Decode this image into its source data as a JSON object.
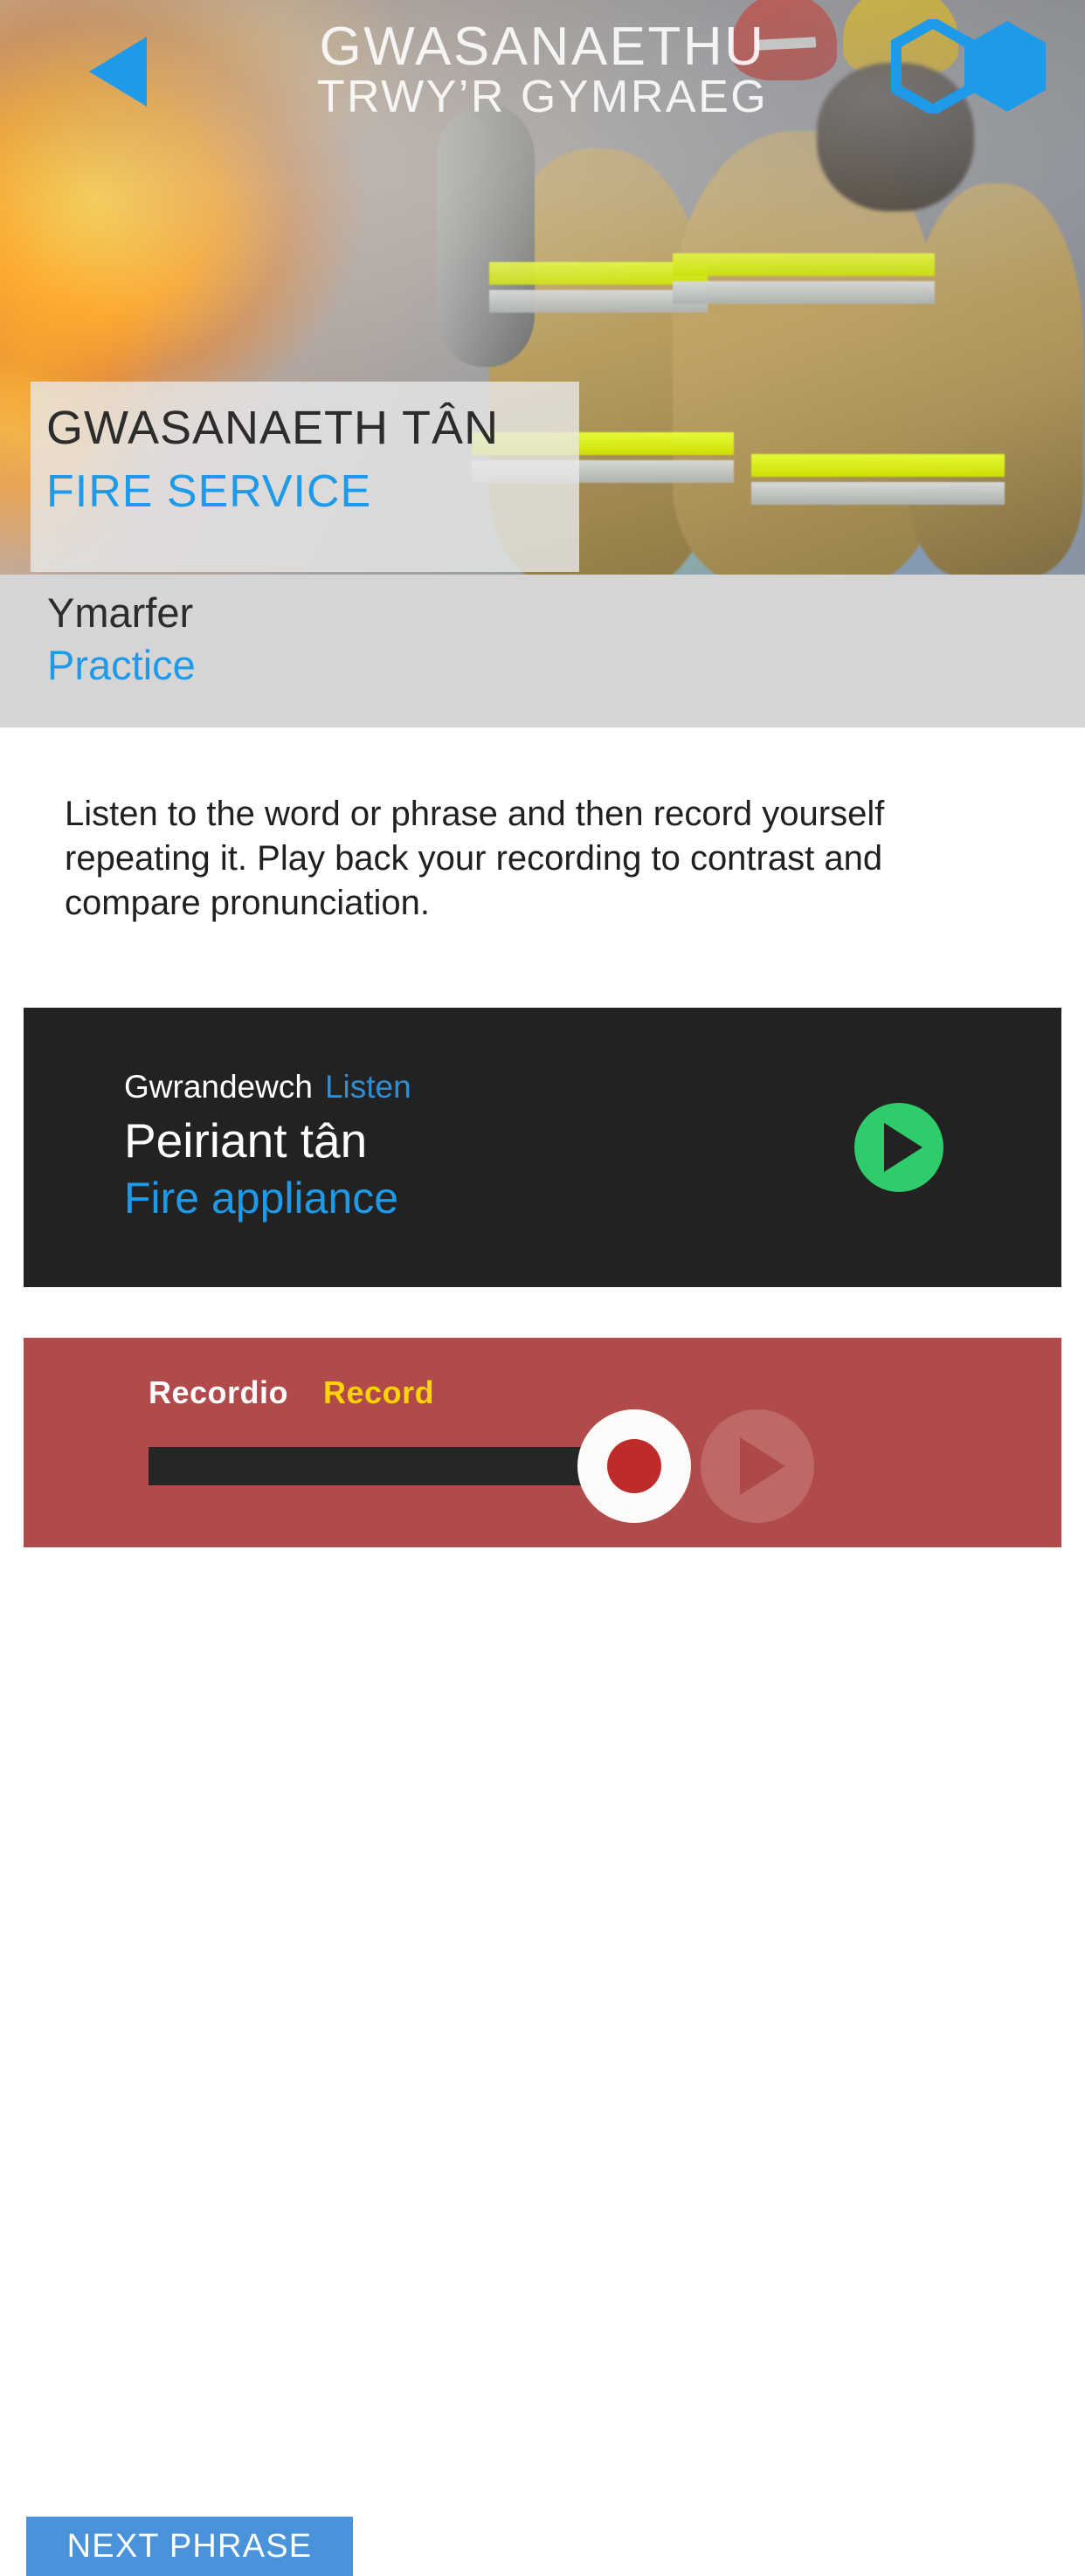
{
  "header": {
    "back_icon": "back-arrow-icon",
    "title_line1": "GWASANAETHU",
    "title_line2": "TRWY’R GYMRAEG",
    "logo_icon": "hexagon-logo-icon"
  },
  "hero": {
    "title_cy": "GWASANAETH TÂN",
    "title_en": "FIRE SERVICE",
    "subtitle_cy": "Ymarfer",
    "subtitle_en": "Practice"
  },
  "main": {
    "instructions": "Listen to the word or phrase and then record yourself repeating it. Play back your recording to contrast and compare pronunciation."
  },
  "listen_panel": {
    "label_cy": "Gwrandewch",
    "label_en": "Listen",
    "word_cy": "Peiriant tân",
    "word_en": "Fire appliance",
    "play_icon": "play-icon"
  },
  "record_panel": {
    "label_cy": "Recordio",
    "label_en": "Record",
    "record_icon": "record-icon",
    "playback_icon": "play-icon",
    "progress_percent": 0
  },
  "footer": {
    "next_label": "NEXT PHRASE"
  },
  "colors": {
    "accent_blue": "#1e9ae8",
    "button_blue": "#4a92d9",
    "listen_panel": "#222222",
    "record_panel": "#b14a4a",
    "record_dot": "#bf2b2b",
    "play_green": "#2ecc6a",
    "record_label_yellow": "#ffd400",
    "band_grey": "#d5d5d5",
    "plate_grey": "#e8e8e8"
  }
}
